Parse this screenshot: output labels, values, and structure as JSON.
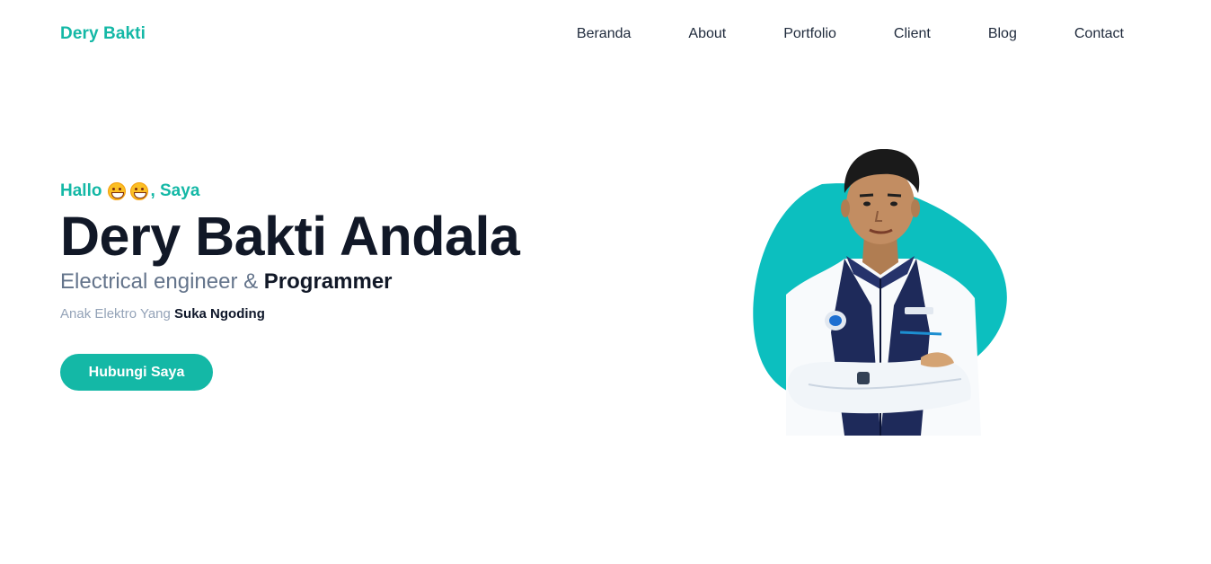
{
  "nav": {
    "brand": "Dery Bakti",
    "items": [
      {
        "label": "Beranda"
      },
      {
        "label": "About"
      },
      {
        "label": "Portfolio"
      },
      {
        "label": "Client"
      },
      {
        "label": "Blog"
      },
      {
        "label": "Contact"
      }
    ]
  },
  "hero": {
    "greeting_prefix": "Hallo",
    "greeting_emoji": "grinning-face-icon",
    "greeting_suffix": ", Saya",
    "name": "Dery Bakti Andala",
    "role_prefix": "Electrical engineer & ",
    "role_highlight": "Programmer",
    "tagline_prefix": "Anak Elektro Yang ",
    "tagline_highlight": "Suka Ngoding",
    "cta_label": "Hubungi Saya"
  },
  "colors": {
    "accent": "#14b8a6",
    "blob": "#0cbfbf",
    "heading": "#111827",
    "muted": "#64748b"
  }
}
